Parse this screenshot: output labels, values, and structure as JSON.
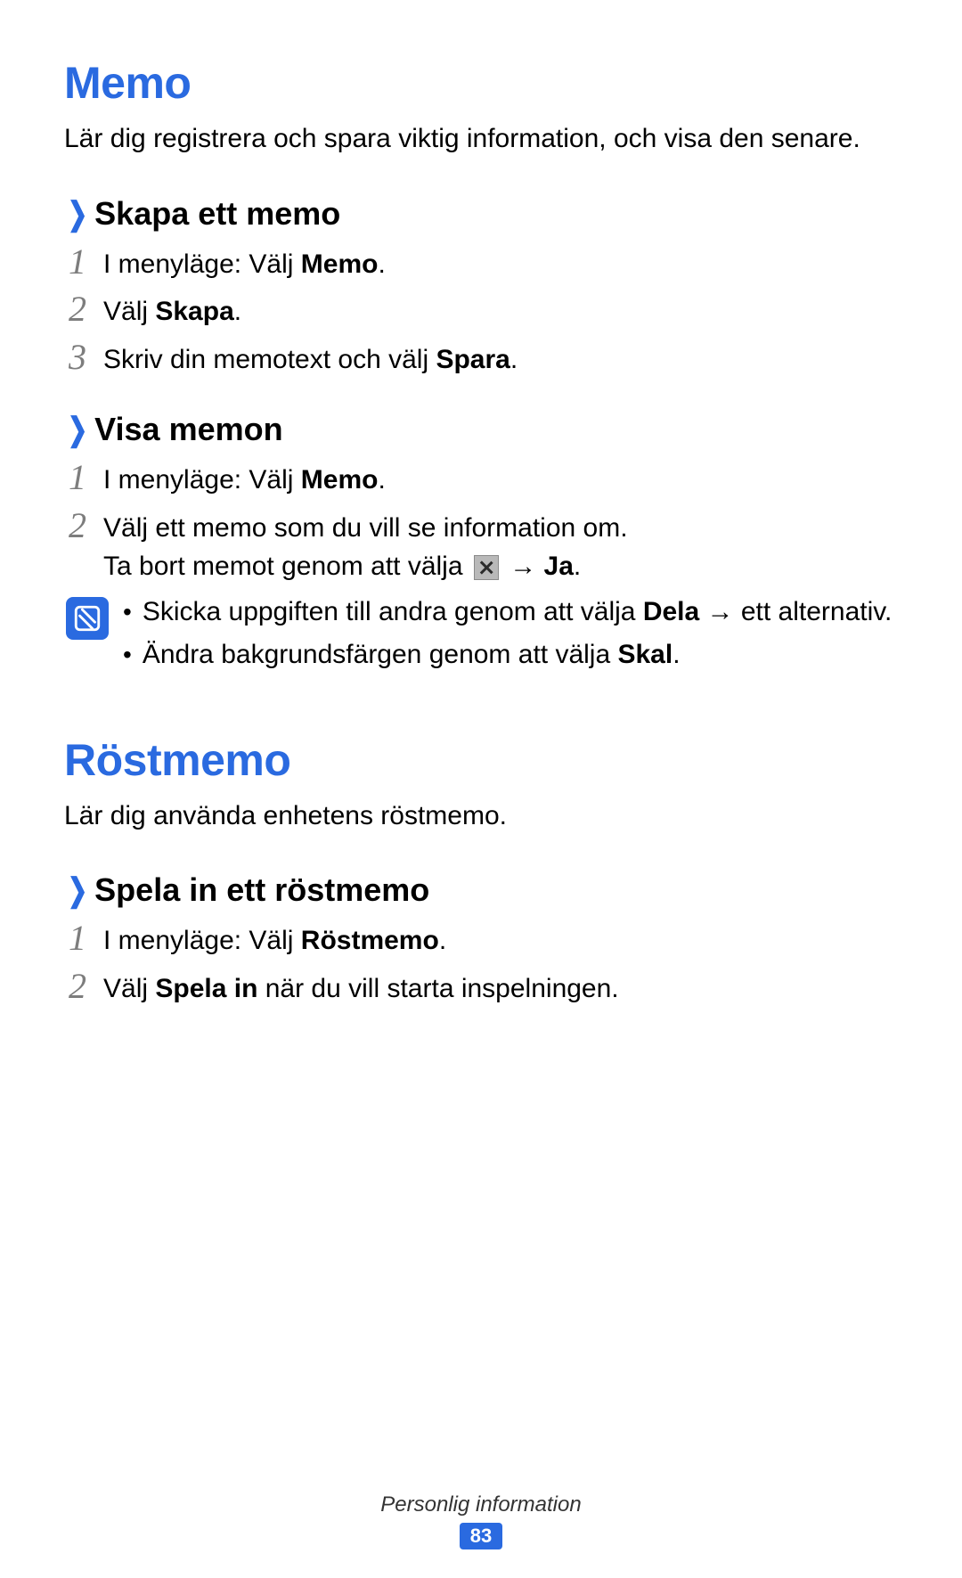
{
  "sections": [
    {
      "title": "Memo",
      "intro": "Lär dig registrera och spara viktig information, och visa den senare.",
      "subs": [
        {
          "heading": "Skapa ett memo",
          "steps": [
            {
              "num": "1",
              "pre": "I menyläge: Välj ",
              "bold": "Memo",
              "post": "."
            },
            {
              "num": "2",
              "pre": "Välj ",
              "bold": "Skapa",
              "post": "."
            },
            {
              "num": "3",
              "pre": "Skriv din memotext och välj ",
              "bold": "Spara",
              "post": "."
            }
          ]
        },
        {
          "heading": "Visa memon",
          "steps": [
            {
              "num": "1",
              "pre": "I menyläge: Välj ",
              "bold": "Memo",
              "post": "."
            },
            {
              "num": "2",
              "line1": "Välj ett memo som du vill se information om.",
              "line2_pre": "Ta bort memot genom att välja ",
              "line2_arrow": " → ",
              "line2_bold": "Ja",
              "line2_post": "."
            }
          ],
          "note": {
            "bullets": [
              {
                "pre": "Skicka uppgiften till andra genom att välja ",
                "bold": "Dela",
                "arrow": " → ",
                "post_pre": "ett alternativ."
              },
              {
                "pre": "Ändra bakgrundsfärgen genom att välja ",
                "bold": "Skal",
                "post": "."
              }
            ]
          }
        }
      ]
    },
    {
      "title": "Röstmemo",
      "intro": "Lär dig använda enhetens röstmemo.",
      "subs": [
        {
          "heading": "Spela in ett röstmemo",
          "steps": [
            {
              "num": "1",
              "pre": "I menyläge: Välj ",
              "bold": "Röstmemo",
              "post": "."
            },
            {
              "num": "2",
              "pre": "Välj ",
              "bold": "Spela in",
              "post": " när du vill starta inspelningen."
            }
          ]
        }
      ]
    }
  ],
  "footer": {
    "label": "Personlig information",
    "page": "83"
  }
}
